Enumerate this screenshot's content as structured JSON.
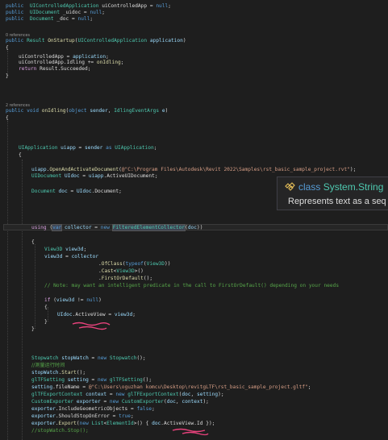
{
  "code": {
    "decl_app": "uiControlledApp",
    "decl_uidoc": "_uidoc",
    "decl_doc": "_doc",
    "null": "null",
    "refs0": "0 references",
    "refs2": "2 references",
    "startup_method": "OnStartup",
    "startup_param": "application",
    "startup_assign": "uiControlledApp",
    "startup_app_val": "application",
    "idling_evt": "Idling",
    "on_idling": "onIdling",
    "result_succeeded": "Result.Succeeded",
    "idling_method": "onIdling",
    "sender": "sender",
    "event_args_type": "IdlingEventArgs",
    "e_param": "e",
    "uiapp": "uiapp",
    "open_method": "OpenAndActivateDocument",
    "revit_path": "@\"C:\\Program Files\\Autodesk\\Revit 2022\\Samples\\rst_basic_sample_project.rvt\"",
    "active_uidoc": "ActiveUIDocument",
    "uidoc": "UIdoc",
    "doc_var": "doc",
    "document_prop": "Document",
    "collector": "collector",
    "fec_type": "FilteredElementCollector",
    "view3d": "view3d",
    "ofclass": "OfClass",
    "view3d_type": "View3D",
    "cast": "Cast",
    "first": "FirstOrDefault",
    "note_comment": "// Note: may want an intelligent predicate in the call to FirstOrDefault() depending on your needs",
    "activeview": "ActiveView",
    "stopwatch_type": "Stopwatch",
    "stopwatch": "stopWatch",
    "chinese_comment": "//测量运行时间",
    "start": "Start",
    "setting_type": "glTFSetting",
    "setting": "setting",
    "filename_prop": "fileName",
    "gltf_path": "@\"C:\\Users\\oguzhan komcu\\Desktop\\revitgLTF\\rst_basic_sample_project.gltf\"",
    "context_type": "glTFExportContext",
    "context": "context",
    "exporter_type": "CustomExporter",
    "exporter": "exporter",
    "include_geom": "IncludeGeometricObjects",
    "false": "false",
    "should_stop": "ShouldStopOnError",
    "true": "true",
    "export": "Export",
    "list_type": "List",
    "elementid_type": "ElementId",
    "id_prop": "Id",
    "stop_comment": "//stopWatch.Stop();"
  },
  "tooltip": {
    "keyword": "class",
    "type_name": "System.String",
    "description": "Represents text as a seq"
  },
  "colors": {
    "background": "#1e1e1e",
    "keyword": "#569cd6",
    "type": "#4ec9b0",
    "method": "#dcdcaa",
    "variable": "#9cdcfe",
    "string": "#d69d85",
    "comment": "#57a64a",
    "squiggle": "#e8427c"
  }
}
